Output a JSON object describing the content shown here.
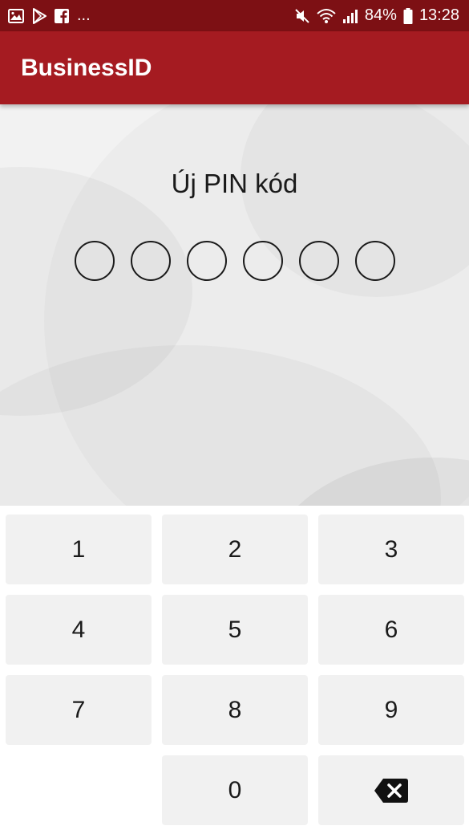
{
  "status_bar": {
    "left_icons": [
      "image-icon",
      "play-store-icon",
      "facebook-icon"
    ],
    "more": "...",
    "right_icons": [
      "mute-icon",
      "wifi-icon",
      "signal-icon"
    ],
    "battery": "84%",
    "time": "13:28"
  },
  "app_bar": {
    "title": "BusinessID"
  },
  "pin": {
    "title": "Új PIN kód",
    "length": 6
  },
  "keypad": {
    "keys": [
      "1",
      "2",
      "3",
      "4",
      "5",
      "6",
      "7",
      "8",
      "9",
      "0"
    ],
    "backspace_icon": "backspace-icon"
  },
  "colors": {
    "status_bar": "#7d1014",
    "app_bar": "#a51b21",
    "background": "#f2f2f2",
    "key": "#f1f1f1"
  }
}
